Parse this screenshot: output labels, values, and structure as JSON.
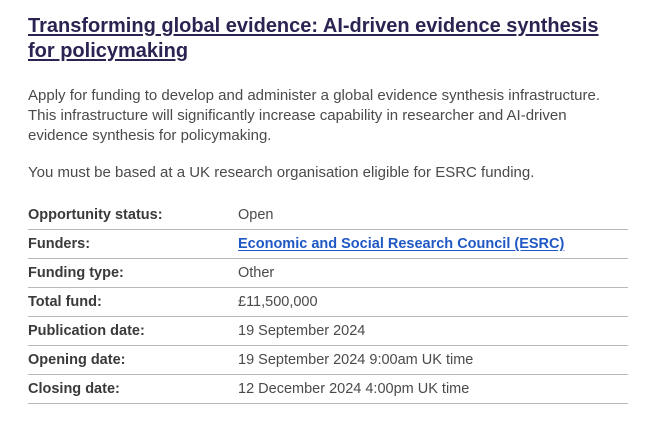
{
  "opportunity": {
    "title": "Transforming global evidence: AI-driven evidence synthesis for policymaking",
    "description": "Apply for funding to develop and administer a global evidence synthesis infrastructure. This infrastructure will significantly increase capability in researcher and AI-driven evidence synthesis for policymaking.",
    "eligibility": "You must be based at a UK research organisation eligible for ESRC funding."
  },
  "details": {
    "status_label": "Opportunity status:",
    "status_value": "Open",
    "funders_label": "Funders:",
    "funders_value": "Economic and Social Research Council (ESRC)",
    "funding_type_label": "Funding type:",
    "funding_type_value": "Other",
    "total_fund_label": "Total fund:",
    "total_fund_value": "£11,500,000",
    "publication_date_label": "Publication date:",
    "publication_date_value": "19 September 2024",
    "opening_date_label": "Opening date:",
    "opening_date_value": "19 September 2024 9:00am UK time",
    "closing_date_label": "Closing date:",
    "closing_date_value": "12 December 2024 4:00pm UK time"
  },
  "colors": {
    "title": "#2b2452",
    "link": "#1f58c4",
    "divider": "#b8b8b8"
  }
}
